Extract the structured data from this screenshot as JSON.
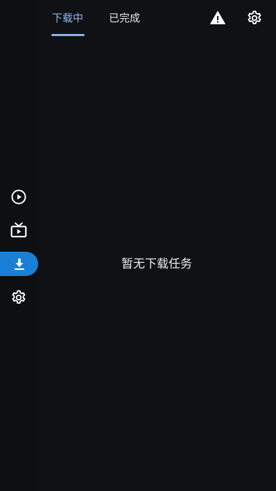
{
  "tabs": [
    {
      "label": "下载中",
      "active": true
    },
    {
      "label": "已完成",
      "active": false
    }
  ],
  "header_icons": [
    "warning-icon",
    "settings-icon"
  ],
  "nav_rail": [
    {
      "icon": "play-circle-icon",
      "active": false
    },
    {
      "icon": "tv-icon",
      "active": false
    },
    {
      "icon": "download-icon",
      "active": true
    },
    {
      "icon": "settings-icon",
      "active": false
    }
  ],
  "empty_state": {
    "message": "暂无下载任务"
  },
  "colors": {
    "background": "#101114",
    "accent_blue": "#1a7fd6",
    "active_tab_text": "#8cb8f0",
    "text": "#e6e6e6"
  }
}
